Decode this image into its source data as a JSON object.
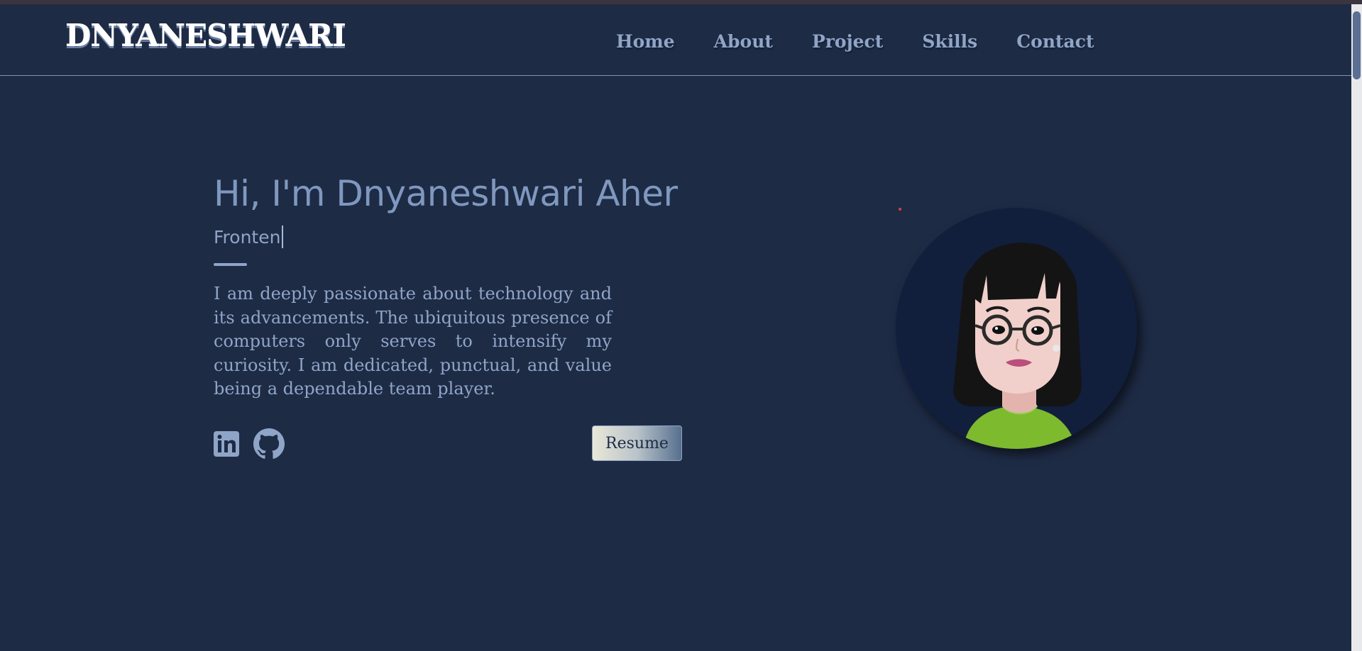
{
  "brand": {
    "logo": "DNYANESHWARI"
  },
  "nav": {
    "items": [
      {
        "label": "Home"
      },
      {
        "label": "About"
      },
      {
        "label": "Project"
      },
      {
        "label": "Skills"
      },
      {
        "label": "Contact"
      }
    ]
  },
  "hero": {
    "title": "Hi, I'm Dnyaneshwari Aher",
    "typed_text": "Fronten",
    "bio": "I am deeply passionate about technology and its advancements. The ubiquitous presence of computers only serves to intensify my curiosity. I am dedicated, punctual, and value being a dependable team player.",
    "resume_label": "Resume",
    "social_icons": [
      "linkedin-icon",
      "github-icon"
    ]
  },
  "colors": {
    "background": "#1e2b45",
    "text": "#8fa5c8",
    "avatar_bg": "#111f3d",
    "shirt": "#7dba2e"
  }
}
